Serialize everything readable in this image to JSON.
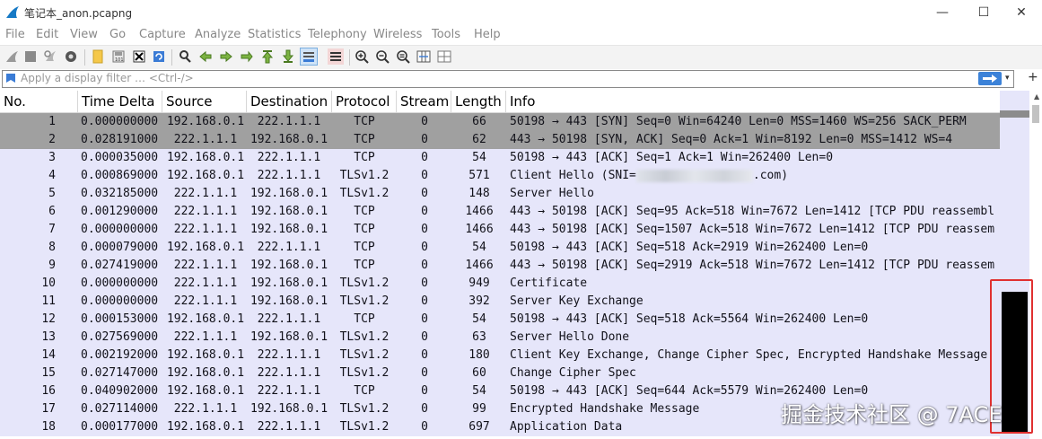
{
  "window": {
    "title": "笔记本_anon.pcapng",
    "min_glyph": "—",
    "max_glyph": "☐",
    "close_glyph": "✕"
  },
  "menu": [
    "File",
    "Edit",
    "View",
    "Go",
    "Capture",
    "Analyze",
    "Statistics",
    "Telephony",
    "Wireless",
    "Tools",
    "Help"
  ],
  "filter": {
    "placeholder": "Apply a display filter … <Ctrl-/>",
    "plus": "+"
  },
  "columns": {
    "no": "No.",
    "time": "Time Delta",
    "src": "Source",
    "dst": "Destination",
    "proto": "Protocol",
    "stream": "Stream",
    "len": "Length",
    "info": "Info"
  },
  "rows": [
    {
      "no": "1",
      "time": "0.000000000",
      "src": "192.168.0.1",
      "dst": "222.1.1.1",
      "proto": "TCP",
      "stream": "0",
      "len": "66",
      "info": "50198 → 443 [SYN] Seq=0 Win=64240 Len=0 MSS=1460 WS=256 SACK_PERM",
      "sel": true
    },
    {
      "no": "2",
      "time": "0.028191000",
      "src": "222.1.1.1",
      "dst": "192.168.0.1",
      "proto": "TCP",
      "stream": "0",
      "len": "62",
      "info": "443 → 50198 [SYN, ACK] Seq=0 Ack=1 Win=8192 Len=0 MSS=1412 WS=4",
      "sel": true
    },
    {
      "no": "3",
      "time": "0.000035000",
      "src": "192.168.0.1",
      "dst": "222.1.1.1",
      "proto": "TCP",
      "stream": "0",
      "len": "54",
      "info": "50198 → 443 [ACK] Seq=1 Ack=1 Win=262400 Len=0"
    },
    {
      "no": "4",
      "time": "0.000869000",
      "src": "192.168.0.1",
      "dst": "222.1.1.1",
      "proto": "TLSv1.2",
      "stream": "0",
      "len": "571",
      "info": "Client Hello (SNI=",
      "info_tail": ".com)",
      "blurred": true
    },
    {
      "no": "5",
      "time": "0.032185000",
      "src": "222.1.1.1",
      "dst": "192.168.0.1",
      "proto": "TLSv1.2",
      "stream": "0",
      "len": "148",
      "info": "Server Hello"
    },
    {
      "no": "6",
      "time": "0.001290000",
      "src": "222.1.1.1",
      "dst": "192.168.0.1",
      "proto": "TCP",
      "stream": "0",
      "len": "1466",
      "info": "443 → 50198 [ACK] Seq=95 Ack=518 Win=7672 Len=1412 [TCP PDU reassembl"
    },
    {
      "no": "7",
      "time": "0.000000000",
      "src": "222.1.1.1",
      "dst": "192.168.0.1",
      "proto": "TCP",
      "stream": "0",
      "len": "1466",
      "info": "443 → 50198 [ACK] Seq=1507 Ack=518 Win=7672 Len=1412 [TCP PDU reassem"
    },
    {
      "no": "8",
      "time": "0.000079000",
      "src": "192.168.0.1",
      "dst": "222.1.1.1",
      "proto": "TCP",
      "stream": "0",
      "len": "54",
      "info": "50198 → 443 [ACK] Seq=518 Ack=2919 Win=262400 Len=0"
    },
    {
      "no": "9",
      "time": "0.027419000",
      "src": "222.1.1.1",
      "dst": "192.168.0.1",
      "proto": "TCP",
      "stream": "0",
      "len": "1466",
      "info": "443 → 50198 [ACK] Seq=2919 Ack=518 Win=7672 Len=1412 [TCP PDU reassem"
    },
    {
      "no": "10",
      "time": "0.000000000",
      "src": "222.1.1.1",
      "dst": "192.168.0.1",
      "proto": "TLSv1.2",
      "stream": "0",
      "len": "949",
      "info": "Certificate"
    },
    {
      "no": "11",
      "time": "0.000000000",
      "src": "222.1.1.1",
      "dst": "192.168.0.1",
      "proto": "TLSv1.2",
      "stream": "0",
      "len": "392",
      "info": "Server Key Exchange"
    },
    {
      "no": "12",
      "time": "0.000153000",
      "src": "192.168.0.1",
      "dst": "222.1.1.1",
      "proto": "TCP",
      "stream": "0",
      "len": "54",
      "info": "50198 → 443 [ACK] Seq=518 Ack=5564 Win=262400 Len=0"
    },
    {
      "no": "13",
      "time": "0.027569000",
      "src": "222.1.1.1",
      "dst": "192.168.0.1",
      "proto": "TLSv1.2",
      "stream": "0",
      "len": "63",
      "info": "Server Hello Done"
    },
    {
      "no": "14",
      "time": "0.002192000",
      "src": "192.168.0.1",
      "dst": "222.1.1.1",
      "proto": "TLSv1.2",
      "stream": "0",
      "len": "180",
      "info": "Client Key Exchange, Change Cipher Spec, Encrypted Handshake Message"
    },
    {
      "no": "15",
      "time": "0.027147000",
      "src": "192.168.0.1",
      "dst": "222.1.1.1",
      "proto": "TLSv1.2",
      "stream": "0",
      "len": "60",
      "info": "Change Cipher Spec"
    },
    {
      "no": "16",
      "time": "0.040902000",
      "src": "192.168.0.1",
      "dst": "222.1.1.1",
      "proto": "TCP",
      "stream": "0",
      "len": "54",
      "info": "50198 → 443 [ACK] Seq=644 Ack=5579 Win=262400 Len=0"
    },
    {
      "no": "17",
      "time": "0.027114000",
      "src": "222.1.1.1",
      "dst": "192.168.0.1",
      "proto": "TLSv1.2",
      "stream": "0",
      "len": "99",
      "info": "Encrypted Handshake Message"
    },
    {
      "no": "18",
      "time": "0.000177000",
      "src": "192.168.0.1",
      "dst": "222.1.1.1",
      "proto": "TLSv1.2",
      "stream": "0",
      "len": "697",
      "info": "Application Data"
    }
  ],
  "watermark": "掘金技术社区 @ 7ACE",
  "colors": {
    "row_bg": "#e6e6fa",
    "selected_bg": "#a0a0a0",
    "annotation_red": "#e03030",
    "apply_arrow": "#3c82d8"
  }
}
